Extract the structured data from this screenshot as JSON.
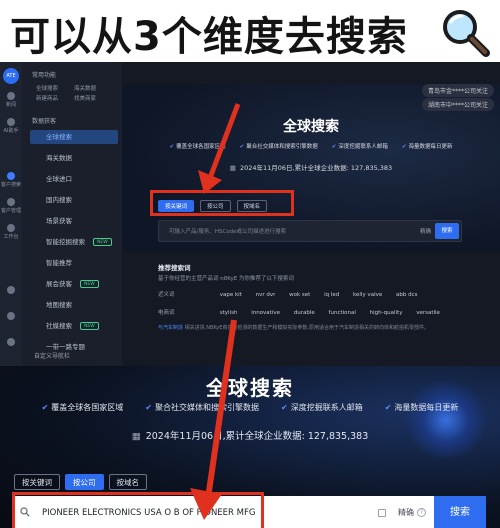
{
  "headline": {
    "text": "可以从3个维度去搜索",
    "icon": "magnifier-icon"
  },
  "sidebar_rail": {
    "avatar": "ATE",
    "items": [
      {
        "label": "新闻"
      },
      {
        "label": "AI助手"
      },
      {
        "label": "客户搜索"
      },
      {
        "label": "客户管理"
      },
      {
        "label": "工作台"
      }
    ]
  },
  "menu": {
    "common": {
      "title": "常用功能",
      "items": [
        "全球搜索",
        "海关数据",
        "新建商品",
        "找美商家"
      ]
    },
    "acquisition": {
      "title": "数据获客",
      "items": [
        {
          "label": "全球搜索",
          "active": true,
          "tag": ""
        },
        {
          "label": "海关数据",
          "active": false,
          "tag": ""
        },
        {
          "label": "全球进口",
          "active": false,
          "tag": ""
        },
        {
          "label": "国内搜索",
          "active": false,
          "tag": ""
        },
        {
          "label": "场景获客",
          "active": false,
          "tag": ""
        },
        {
          "label": "智能挖掘搜索",
          "active": false,
          "tag": "NEW"
        },
        {
          "label": "智能推荐",
          "active": false,
          "tag": ""
        },
        {
          "label": "展会获客",
          "active": false,
          "tag": "NEW"
        },
        {
          "label": "地图搜索",
          "active": false,
          "tag": ""
        },
        {
          "label": "社媒搜索",
          "active": false,
          "tag": "NEW"
        },
        {
          "label": "一带一路专题",
          "active": false,
          "tag": ""
        }
      ]
    },
    "footer": "自定义导航栏"
  },
  "notifications": [
    "青岛市金****公司关注",
    "湖南市中****公司关注"
  ],
  "hero": {
    "title": "全球搜索",
    "features": [
      "覆盖全球各国家区域",
      "聚合社交媒体和搜索引擎数据",
      "深度挖掘联系人邮箱",
      "海量数据每日更新"
    ],
    "stats": "2024年11月06日,累计全球企业数据:  127,835,383",
    "tabs": [
      {
        "label": "按关键词",
        "active": true
      },
      {
        "label": "按公司",
        "active": false
      },
      {
        "label": "按域名",
        "active": false
      }
    ],
    "search_placeholder": "可输入产品/服务、HSCode或公司描述进行搜索",
    "exact_label": "精确",
    "search_button": "搜索"
  },
  "recommend": {
    "title": "推荐搜索词",
    "filter": "基于你经营的主营产品词     n8KyE             为你推荐了以下搜索词",
    "rows": [
      {
        "label": "近义词",
        "keywords": [
          "vape kit",
          "nvr dvr",
          "wok set",
          "iq led",
          "kelly valve",
          "abb dcs"
        ]
      },
      {
        "label": "电商词",
        "keywords": [
          "stylish",
          "innovative",
          "durable",
          "functional",
          "high-quality",
          "versatile"
        ]
      }
    ],
    "desc_link": "与汽车制造",
    "desc_text": "相关进货,NBKyE商在的检测的数据生产和模拟实际参数,原用适合用于汽车制造相关的转向体和航拍机零部件。"
  },
  "zoom": {
    "title": "全球搜索",
    "features": [
      "覆盖全球各国家区域",
      "聚合社交媒体和搜索引擎数据",
      "深度挖掘联系人邮箱",
      "海量数据每日更新"
    ],
    "stats": "2024年11月06日,累计全球企业数据:  127,835,383",
    "tabs": [
      {
        "label": "按关键词",
        "active": false
      },
      {
        "label": "按公司",
        "active": true
      },
      {
        "label": "按域名",
        "active": false
      }
    ],
    "search_value": "PIONEER ELECTRONICS USA O B OF PIONEER MFG",
    "exact_label": "精确",
    "help": "?",
    "search_button": "搜索"
  },
  "colors": {
    "accent": "#2f6df0",
    "highlight": "#e0301e",
    "new_tag": "#3ecf8e"
  }
}
